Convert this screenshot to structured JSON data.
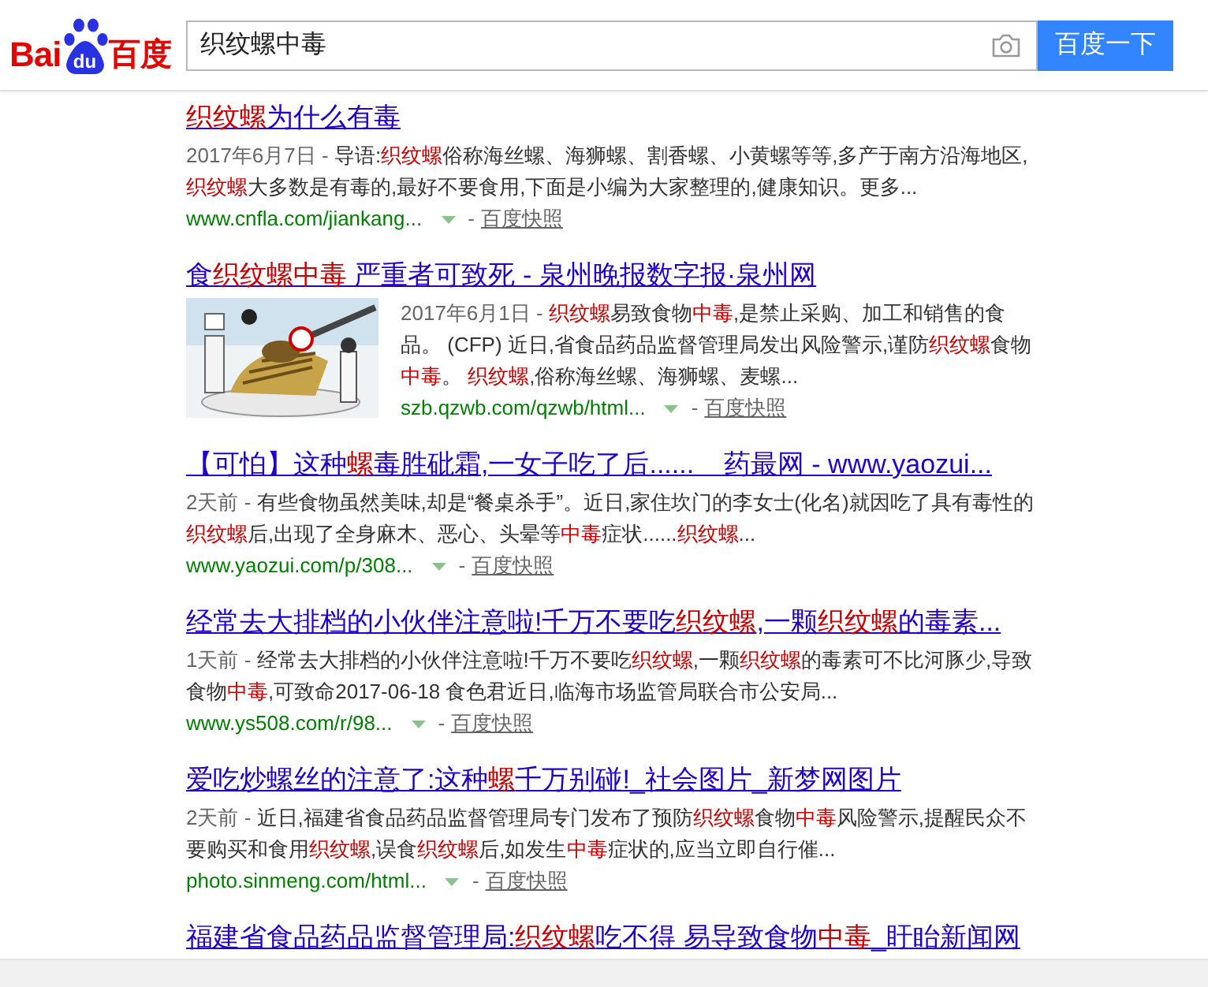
{
  "logo": {
    "left": "Bai",
    "badge": "du",
    "right": "百度"
  },
  "search": {
    "value": "织纹螺中毒",
    "button": "百度一下"
  },
  "results": [
    {
      "title": [
        {
          "kind": "hl",
          "text": "织纹螺"
        },
        {
          "kind": "plain",
          "text": "为什么有毒"
        }
      ],
      "snippet": [
        {
          "kind": "date",
          "text": "2017年6月7日 - "
        },
        {
          "kind": "plain",
          "text": "导语:"
        },
        {
          "kind": "hl",
          "text": "织纹螺"
        },
        {
          "kind": "plain",
          "text": "俗称海丝螺、海狮螺、割香螺、小黄螺等等,多产于南方沿海地区,"
        },
        {
          "kind": "hl",
          "text": "织纹螺"
        },
        {
          "kind": "plain",
          "text": "大多数是有毒的,最好不要食用,下面是小编为大家整理的,健康知识。更多..."
        }
      ],
      "url": "www.cnfla.com/jiankang...",
      "separator": "-",
      "cache": "百度快照"
    },
    {
      "picture": {
        "kind": "picture"
      },
      "title": [
        {
          "kind": "plain",
          "text": "食"
        },
        {
          "kind": "hl",
          "text": "织纹螺中毒"
        },
        {
          "kind": "plain",
          "text": " 严重者可致死 - 泉州晚报数字报·泉州网"
        }
      ],
      "snippet": [
        {
          "kind": "date",
          "text": "2017年6月1日 - "
        },
        {
          "kind": "hl",
          "text": "织纹螺"
        },
        {
          "kind": "plain",
          "text": "易致食物"
        },
        {
          "kind": "hl",
          "text": "中毒"
        },
        {
          "kind": "plain",
          "text": ",是禁止采购、加工和销售的食品。 (CFP) 近日,省食品药品监督管理局发出风险警示,谨防"
        },
        {
          "kind": "hl",
          "text": "织纹螺"
        },
        {
          "kind": "plain",
          "text": "食物"
        },
        {
          "kind": "hl",
          "text": "中毒"
        },
        {
          "kind": "plain",
          "text": "。 "
        },
        {
          "kind": "hl",
          "text": "织纹螺"
        },
        {
          "kind": "plain",
          "text": ",俗称海丝螺、海狮螺、麦螺..."
        }
      ],
      "url": "szb.qzwb.com/qzwb/html...",
      "separator": "-",
      "cache": "百度快照"
    },
    {
      "title": [
        {
          "kind": "plain",
          "text": "【可怕】这种"
        },
        {
          "kind": "hl",
          "text": "螺"
        },
        {
          "kind": "plain",
          "text": "毒胜砒霜,一女子吃了后......    药最网 - www.yaozui..."
        }
      ],
      "snippet": [
        {
          "kind": "date",
          "text": "2天前 - "
        },
        {
          "kind": "plain",
          "text": "有些食物虽然美味,却是“餐桌杀手”。近日,家住坎门的李女士(化名)就因吃了具有毒性的"
        },
        {
          "kind": "hl",
          "text": "织纹螺"
        },
        {
          "kind": "plain",
          "text": "后,出现了全身麻木、恶心、头晕等"
        },
        {
          "kind": "hl",
          "text": "中毒"
        },
        {
          "kind": "plain",
          "text": "症状......"
        },
        {
          "kind": "hl",
          "text": "织纹螺"
        },
        {
          "kind": "plain",
          "text": "..."
        }
      ],
      "url": "www.yaozui.com/p/308...",
      "separator": "-",
      "cache": "百度快照"
    },
    {
      "title": [
        {
          "kind": "plain",
          "text": "经常去大排档的小伙伴注意啦!千万不要吃"
        },
        {
          "kind": "hl",
          "text": "织纹螺"
        },
        {
          "kind": "plain",
          "text": ",一颗"
        },
        {
          "kind": "hl",
          "text": "织纹螺"
        },
        {
          "kind": "plain",
          "text": "的毒素..."
        }
      ],
      "snippet": [
        {
          "kind": "date",
          "text": "1天前 - "
        },
        {
          "kind": "plain",
          "text": "经常去大排档的小伙伴注意啦!千万不要吃"
        },
        {
          "kind": "hl",
          "text": "织纹螺"
        },
        {
          "kind": "plain",
          "text": ",一颗"
        },
        {
          "kind": "hl",
          "text": "织纹螺"
        },
        {
          "kind": "plain",
          "text": "的毒素可不比河豚少,导致食物"
        },
        {
          "kind": "hl",
          "text": "中毒"
        },
        {
          "kind": "plain",
          "text": ",可致命2017-06-18 食色君近日,临海市场监管局联合市公安局..."
        }
      ],
      "url": "www.ys508.com/r/98...",
      "separator": "-",
      "cache": "百度快照"
    },
    {
      "title": [
        {
          "kind": "plain",
          "text": "爱吃炒螺丝的注意了:这种"
        },
        {
          "kind": "hl",
          "text": "螺"
        },
        {
          "kind": "plain",
          "text": "千万别碰!_社会图片_新梦网图片"
        }
      ],
      "snippet": [
        {
          "kind": "date",
          "text": "2天前 - "
        },
        {
          "kind": "plain",
          "text": "近日,福建省食品药品监督管理局专门发布了预防"
        },
        {
          "kind": "hl",
          "text": "织纹螺"
        },
        {
          "kind": "plain",
          "text": "食物"
        },
        {
          "kind": "hl",
          "text": "中毒"
        },
        {
          "kind": "plain",
          "text": "风险警示,提醒民众不要购买和食用"
        },
        {
          "kind": "hl",
          "text": "织纹螺"
        },
        {
          "kind": "plain",
          "text": ",误食"
        },
        {
          "kind": "hl",
          "text": "织纹螺"
        },
        {
          "kind": "plain",
          "text": "后,如发生"
        },
        {
          "kind": "hl",
          "text": "中毒"
        },
        {
          "kind": "plain",
          "text": "症状的,应当立即自行催..."
        }
      ],
      "url": "photo.sinmeng.com/html...",
      "separator": "-",
      "cache": "百度快照"
    },
    {
      "title": [
        {
          "kind": "plain",
          "text": "福建省食品药品监督管理局:"
        },
        {
          "kind": "hl",
          "text": "织纹螺"
        },
        {
          "kind": "plain",
          "text": "吃不得 易导致食物"
        },
        {
          "kind": "hl",
          "text": "中毒"
        },
        {
          "kind": "plain",
          "text": "_盱眙新闻网"
        }
      ]
    }
  ]
}
